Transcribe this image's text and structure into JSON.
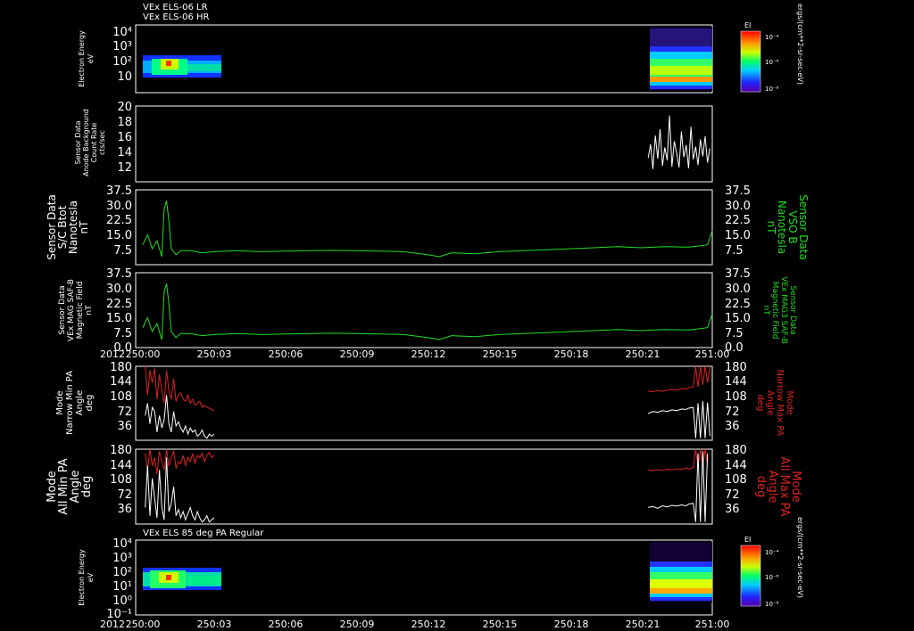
{
  "header": {
    "line1": "VEx ELS-06 LR",
    "line2": "VEx ELS-06 HR",
    "bottom_title": "VEx ELS 85 deg PA Regular"
  },
  "colors": {
    "background": "#000000",
    "frame": "#ffffff",
    "white_trace": "#ffffff",
    "green_trace": "#22dd22",
    "red_trace": "#dd2222"
  },
  "colorbars": {
    "top": {
      "label": "EI",
      "ticks": [
        "10⁻⁴",
        "10⁻⁶",
        "10⁻⁸"
      ],
      "unit_label": "ergs/(cm**2-sr-sec-eV)"
    },
    "bottom": {
      "label": "EI",
      "ticks": [
        "10⁻⁴",
        "10⁻⁶",
        "10⁻⁸"
      ],
      "unit_label": "ergs/(cm**2-sr-sec-eV)"
    }
  },
  "time_axis": {
    "year": "2012",
    "ticks": [
      "250:00",
      "250:03",
      "250:06",
      "250:09",
      "250:12",
      "250:15",
      "250:18",
      "250:21",
      "251:00"
    ]
  },
  "chart_data": [
    {
      "type": "heatmap",
      "name_panel": "spectrogram_top",
      "ylabel_lines": [
        "Electron Energy",
        "eV"
      ],
      "y_ticks": [
        "10⁴",
        "10³",
        "10²",
        "10",
        ""
      ],
      "ylim": [
        1,
        10000
      ],
      "log_scale": true,
      "colorbar_range": [
        1e-08,
        0.0001
      ],
      "data_intervals": [
        {
          "start": "250:00",
          "end": "250:03",
          "energy_range": [
            10,
            200
          ]
        },
        {
          "start": "250:21",
          "end": "251:00",
          "energy_range": [
            3,
            10000
          ]
        }
      ]
    },
    {
      "type": "line",
      "name_panel": "background",
      "ylabel_lines": [
        "Sensor Data",
        "Anode Background",
        "Count Rate",
        "cts/sec"
      ],
      "y_ticks": [
        "20",
        "18",
        "16",
        "14",
        "12"
      ],
      "ylim": [
        10.5,
        20
      ],
      "series": [
        {
          "color": "#ffffff",
          "x": [
            21.3,
            21.4,
            21.5,
            21.6,
            21.7,
            21.8,
            21.9,
            22.0,
            22.1,
            22.2,
            22.3,
            22.4,
            22.5,
            22.6,
            22.7,
            22.8,
            22.9,
            23.0,
            23.1,
            23.2,
            23.3,
            23.4,
            23.5,
            23.6,
            23.7,
            23.8,
            23.9
          ],
          "y": [
            13.5,
            15.2,
            12.1,
            16.3,
            13.4,
            17.1,
            12.5,
            14.8,
            13.2,
            18.8,
            12.4,
            15.6,
            14.1,
            12.3,
            16.8,
            13.6,
            15.1,
            12.2,
            17.4,
            13.3,
            14.9,
            12.6,
            15.8,
            13.7,
            16.2,
            12.9,
            14.7
          ]
        }
      ]
    },
    {
      "type": "line",
      "name_panel": "bvso",
      "ylabel_lines": [
        "Sensor Data",
        "S/C Btot",
        "Nanotesla",
        "nT"
      ],
      "ylabel_right_lines": [
        "Sensor Data",
        "VSO B",
        "Nanotesla",
        "nT"
      ],
      "y_ticks": [
        "37.5",
        "30.0",
        "22.5",
        "15.0",
        "7.5"
      ],
      "ylim": [
        0,
        37.5
      ],
      "series": [
        {
          "color": "#22dd22",
          "x": [
            0.0,
            0.2,
            0.4,
            0.6,
            0.8,
            0.9,
            1.0,
            1.1,
            1.2,
            1.4,
            1.6,
            2.0,
            2.5,
            3,
            4,
            5,
            6,
            7,
            8,
            9,
            10,
            11,
            12,
            12.5,
            13,
            14,
            15,
            16,
            17,
            18,
            19,
            20,
            21,
            22,
            23,
            23.5,
            23.8,
            24.0
          ],
          "y": [
            10,
            15,
            8,
            12,
            4,
            28,
            32,
            22,
            8,
            5,
            7,
            7,
            6,
            6.5,
            7,
            6.5,
            6.8,
            7,
            7.2,
            7,
            6.8,
            6.5,
            5,
            4,
            6,
            5.5,
            6.5,
            7,
            7.5,
            8,
            8.5,
            9,
            8.5,
            9,
            8.8,
            9.5,
            10,
            17
          ]
        }
      ]
    },
    {
      "type": "line",
      "name_panel": "bsafb",
      "ylabel_lines": [
        "Sensor Data",
        "VEx MAG SAF-B",
        "Magnetic Field",
        "nT"
      ],
      "ylabel_right_lines": [
        "Sensor Data",
        "VEx MAG3 SAF-B",
        "Magnetic Field",
        "nT"
      ],
      "y_ticks": [
        "37.5",
        "30.0",
        "22.5",
        "15.0",
        "7.5",
        "0.0"
      ],
      "ylim": [
        0,
        37.5
      ],
      "series": [
        {
          "color": "#22dd22",
          "x": [
            0.0,
            0.2,
            0.4,
            0.6,
            0.8,
            0.9,
            1.0,
            1.1,
            1.2,
            1.4,
            1.6,
            2.0,
            2.5,
            3,
            4,
            5,
            6,
            7,
            8,
            9,
            10,
            11,
            12,
            12.5,
            13,
            14,
            15,
            16,
            17,
            18,
            19,
            20,
            21,
            22,
            23,
            23.5,
            23.8,
            24.0
          ],
          "y": [
            10,
            15,
            8,
            12,
            4,
            28,
            32,
            22,
            8,
            5,
            7,
            7,
            6,
            6.5,
            7,
            6.5,
            6.8,
            7,
            7.2,
            7,
            6.8,
            6.5,
            5,
            4,
            6,
            5.5,
            6.5,
            7,
            7.5,
            8,
            8.5,
            9,
            8.5,
            9,
            8.8,
            9.5,
            10,
            17
          ]
        }
      ]
    },
    {
      "type": "line",
      "name_panel": "narrow_pa",
      "ylabel_lines": [
        "Mode",
        "Narrow Min PA",
        "Angle",
        "deg"
      ],
      "ylabel_right_lines": [
        "Mode",
        "Narrow Max PA",
        "Angle",
        "deg"
      ],
      "y_ticks": [
        "180",
        "144",
        "108",
        "72",
        "36"
      ],
      "ylim": [
        0,
        180
      ],
      "series": [
        {
          "color": "#dd2222",
          "x": [
            0.1,
            0.2,
            0.3,
            0.4,
            0.5,
            0.6,
            0.7,
            0.8,
            0.9,
            1.0,
            1.1,
            1.2,
            1.3,
            1.4,
            1.5,
            1.6,
            1.7,
            1.8,
            1.9,
            2.0,
            2.1,
            2.2,
            2.3,
            2.4,
            2.5,
            2.6,
            2.7,
            2.8,
            2.9,
            3.0,
            null,
            21.3,
            21.5,
            21.7,
            21.9,
            22.1,
            22.3,
            22.5,
            22.7,
            22.9,
            23.0,
            23.2,
            23.3,
            23.4,
            23.5,
            23.6,
            23.7,
            23.8,
            23.9
          ],
          "y": [
            180,
            110,
            170,
            140,
            175,
            100,
            160,
            120,
            90,
            170,
            120,
            100,
            150,
            95,
            110,
            115,
            100,
            95,
            110,
            90,
            100,
            85,
            90,
            95,
            80,
            85,
            80,
            78,
            75,
            72,
            null,
            120,
            118,
            121,
            119,
            122,
            124,
            122,
            126,
            125,
            128,
            130,
            180,
            130,
            180,
            135,
            180,
            140,
            180
          ]
        },
        {
          "color": "#ffffff",
          "x": [
            0.1,
            0.2,
            0.3,
            0.4,
            0.5,
            0.6,
            0.7,
            0.8,
            0.9,
            1.0,
            1.1,
            1.2,
            1.3,
            1.4,
            1.5,
            1.6,
            1.7,
            1.8,
            1.9,
            2.0,
            2.1,
            2.2,
            2.3,
            2.4,
            2.5,
            2.6,
            2.7,
            2.8,
            2.9,
            3.0,
            null,
            21.3,
            21.5,
            21.7,
            21.9,
            22.1,
            22.3,
            22.5,
            22.7,
            22.9,
            23.0,
            23.2,
            23.3,
            23.4,
            23.5,
            23.6,
            23.7,
            23.8,
            23.9
          ],
          "y": [
            60,
            90,
            40,
            80,
            70,
            20,
            60,
            30,
            50,
            110,
            40,
            20,
            70,
            35,
            45,
            30,
            20,
            35,
            15,
            30,
            20,
            25,
            10,
            15,
            25,
            10,
            5,
            15,
            10,
            15,
            null,
            65,
            70,
            68,
            72,
            70,
            74,
            72,
            76,
            75,
            78,
            80,
            5,
            90,
            5,
            95,
            5,
            92,
            10
          ]
        }
      ]
    },
    {
      "type": "line",
      "name_panel": "all_pa",
      "ylabel_lines": [
        "Mode",
        "All Min PA",
        "Angle",
        "deg"
      ],
      "ylabel_right_lines": [
        "Mode",
        "All Max PA",
        "Angle",
        "deg"
      ],
      "y_ticks": [
        "180",
        "144",
        "108",
        "72",
        "36"
      ],
      "ylim": [
        0,
        180
      ],
      "series": [
        {
          "color": "#dd2222",
          "x": [
            0.1,
            0.2,
            0.3,
            0.4,
            0.5,
            0.6,
            0.7,
            0.8,
            0.9,
            1.0,
            1.1,
            1.2,
            1.3,
            1.4,
            1.5,
            1.6,
            1.7,
            1.8,
            1.9,
            2.0,
            2.1,
            2.2,
            2.3,
            2.4,
            2.5,
            2.6,
            2.7,
            2.8,
            2.9,
            3.0,
            null,
            21.3,
            21.5,
            21.7,
            21.9,
            22.1,
            22.3,
            22.5,
            22.7,
            22.9,
            23.0,
            23.2,
            23.3,
            23.4,
            23.5,
            23.6,
            23.7,
            23.8
          ],
          "y": [
            170,
            130,
            180,
            140,
            160,
            120,
            175,
            150,
            130,
            180,
            140,
            160,
            175,
            135,
            150,
            145,
            165,
            140,
            160,
            150,
            170,
            145,
            165,
            160,
            170,
            150,
            165,
            172,
            160,
            165,
            null,
            130,
            128,
            131,
            129,
            132,
            130,
            133,
            131,
            135,
            132,
            136,
            180,
            138,
            180,
            140,
            180,
            140
          ]
        },
        {
          "color": "#ffffff",
          "x": [
            0.1,
            0.2,
            0.3,
            0.4,
            0.5,
            0.6,
            0.7,
            0.8,
            0.9,
            1.0,
            1.1,
            1.2,
            1.3,
            1.4,
            1.5,
            1.6,
            1.7,
            1.8,
            1.9,
            2.0,
            2.1,
            2.2,
            2.3,
            2.4,
            2.5,
            2.6,
            2.7,
            2.8,
            2.9,
            3.0,
            null,
            21.3,
            21.5,
            21.7,
            21.9,
            22.1,
            22.3,
            22.5,
            22.7,
            22.9,
            23.0,
            23.2,
            23.3,
            23.4,
            23.5,
            23.6,
            23.7,
            23.8
          ],
          "y": [
            40,
            140,
            20,
            110,
            60,
            15,
            130,
            40,
            10,
            160,
            30,
            50,
            90,
            20,
            35,
            15,
            30,
            10,
            25,
            40,
            20,
            10,
            30,
            15,
            5,
            10,
            20,
            5,
            10,
            15,
            null,
            40,
            42,
            38,
            44,
            41,
            45,
            43,
            46,
            44,
            48,
            50,
            5,
            170,
            5,
            175,
            5,
            170
          ]
        }
      ]
    },
    {
      "type": "heatmap",
      "name_panel": "spectrogram_bottom",
      "ylabel_lines": [
        "Electron Energy",
        "eV"
      ],
      "y_ticks": [
        "10⁴",
        "10³",
        "10²",
        "10¹",
        "10⁰",
        "10⁻¹"
      ],
      "ylim": [
        0.1,
        10000
      ],
      "log_scale": true,
      "colorbar_range": [
        1e-08,
        0.0001
      ],
      "data_intervals": [
        {
          "start": "250:00",
          "end": "250:03",
          "energy_range": [
            3,
            200
          ]
        },
        {
          "start": "250:21",
          "end": "251:00",
          "energy_range": [
            3,
            10000
          ]
        }
      ]
    }
  ]
}
